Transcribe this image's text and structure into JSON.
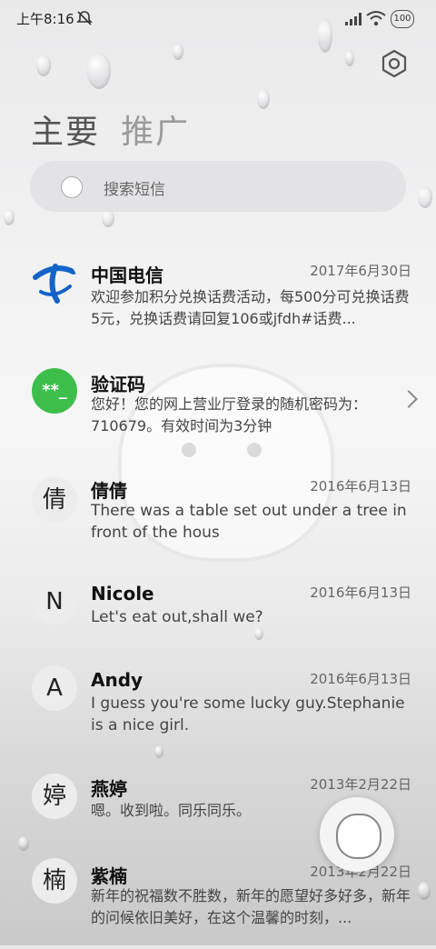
{
  "status_bar": {
    "time": "上午8:16",
    "battery": "100"
  },
  "tabs": [
    {
      "label": "主要"
    },
    {
      "label": "推广"
    }
  ],
  "search": {
    "placeholder": "搜索短信"
  },
  "messages": [
    {
      "name": "中国电信",
      "date": "2017年6月30日",
      "preview": "欢迎参加积分兑换话费活动，每500分可兑换话费5元，兑换话费请回复106或jfdh#话费...",
      "avatar_text": ""
    },
    {
      "name": "验证码",
      "date": "",
      "preview": "您好！您的网上营业厅登录的随机密码为：710679。有效时间为3分钟",
      "avatar_text": "**_"
    },
    {
      "name": "倩倩",
      "date": "2016年6月13日",
      "preview": "There was a table set out under a tree in front of the hous",
      "avatar_text": "倩"
    },
    {
      "name": "Nicole",
      "date": "2016年6月13日",
      "preview": "Let's eat out,shall we?",
      "avatar_text": "N"
    },
    {
      "name": "Andy",
      "date": "2016年6月13日",
      "preview": "I guess you're some lucky guy.Stephanie is a nice girl.",
      "avatar_text": "A"
    },
    {
      "name": "燕婷",
      "date": "2013年2月22日",
      "preview": "嗯。收到啦。同乐同乐。",
      "avatar_text": "婷"
    },
    {
      "name": "紫楠",
      "date": "2013年2月22日",
      "preview": "新年的祝福数不胜数，新年的愿望好多好多，新年的问候依旧美好，在这个温馨的时刻，...",
      "avatar_text": "楠"
    }
  ],
  "colors": {
    "telecom_blue": "#1363c7",
    "code_green": "#3dbe4b"
  },
  "icons": {
    "settings": "settings-icon",
    "search": "cat-search-icon",
    "fab": "cat-compose-icon"
  }
}
